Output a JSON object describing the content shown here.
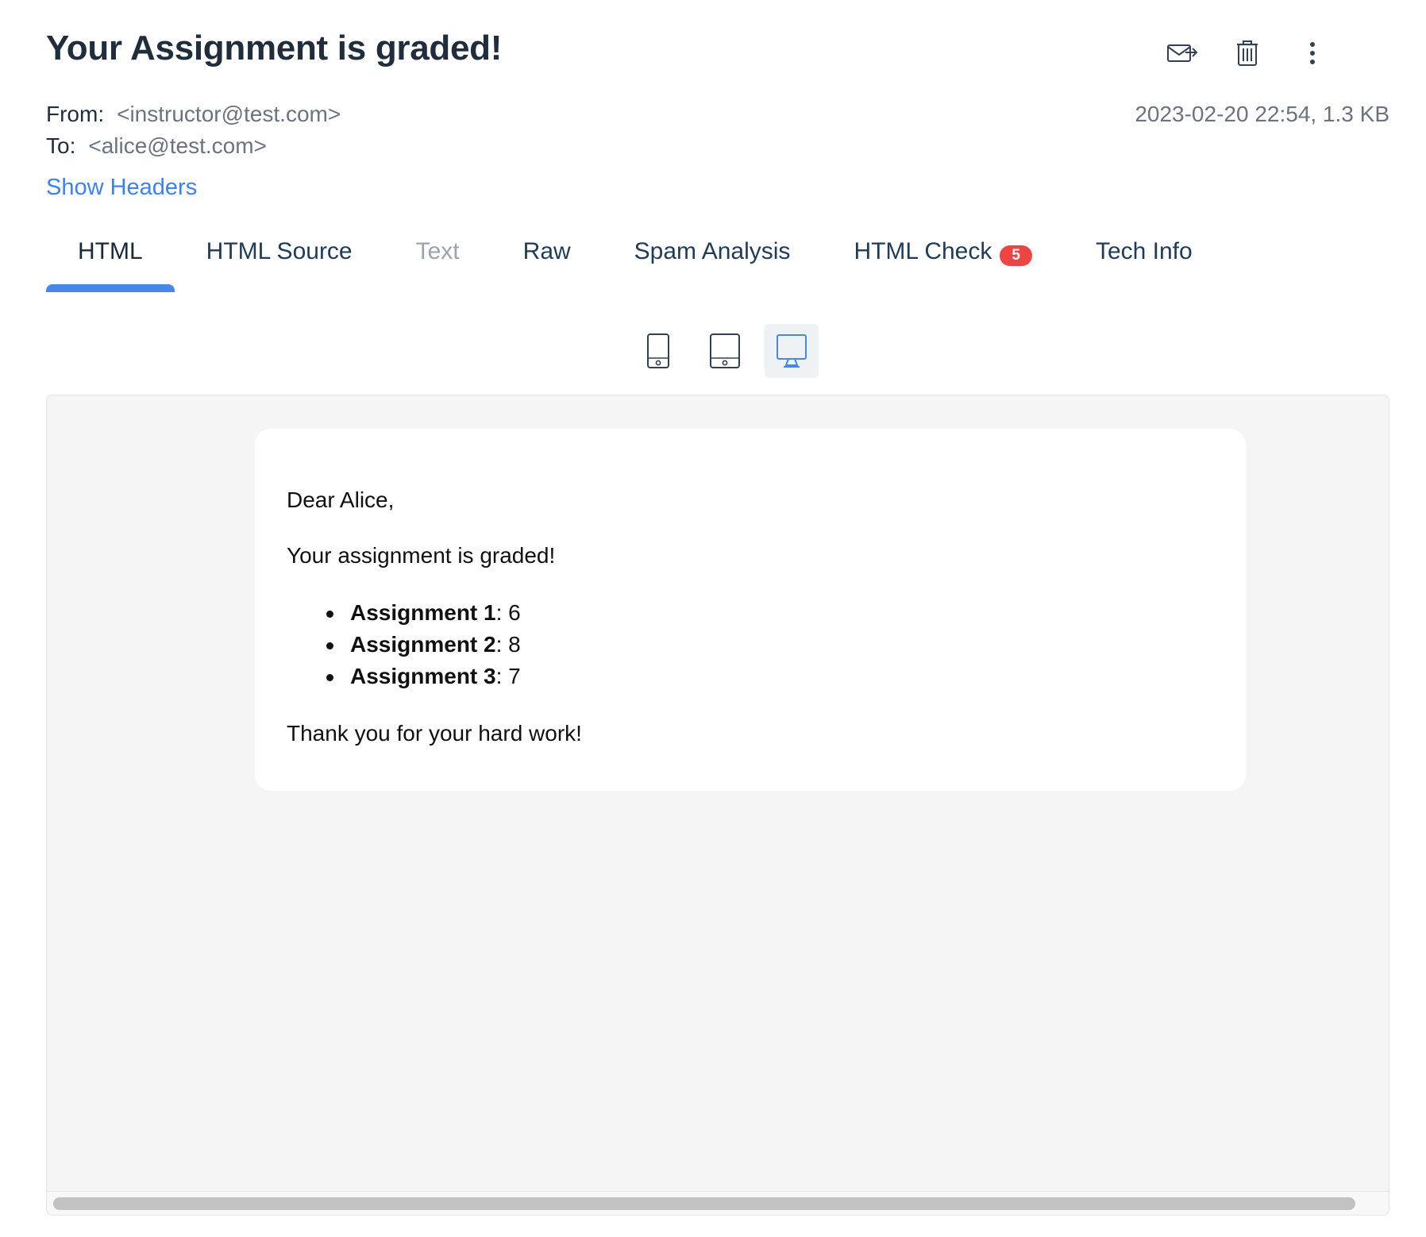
{
  "email": {
    "subject": "Your Assignment is graded!",
    "from_label": "From:",
    "from_value": "<instructor@test.com>",
    "to_label": "To:",
    "to_value": "<alice@test.com>",
    "date_size": "2023-02-20 22:54, 1.3 KB",
    "show_headers": "Show Headers"
  },
  "actions": [
    {
      "icon": "release-mail-icon"
    },
    {
      "icon": "trash-icon"
    },
    {
      "icon": "more-vertical-icon"
    }
  ],
  "tabs": [
    {
      "label": "HTML",
      "active": true
    },
    {
      "label": "HTML Source"
    },
    {
      "label": "Text",
      "disabled": true
    },
    {
      "label": "Raw"
    },
    {
      "label": "Spam Analysis"
    },
    {
      "label": "HTML Check",
      "badge": "5"
    },
    {
      "label": "Tech Info"
    }
  ],
  "devices": [
    {
      "icon": "phone-icon"
    },
    {
      "icon": "tablet-icon"
    },
    {
      "icon": "desktop-icon",
      "active": true
    }
  ],
  "colors": {
    "accent": "#4a86e8",
    "link": "#3b82f6",
    "badge": "#ef4444",
    "title": "#1f2d3d"
  },
  "body": {
    "greeting": "Dear Alice,",
    "intro": "Your assignment is graded!",
    "grades": [
      {
        "name": "Assignment 1",
        "score": ": 6"
      },
      {
        "name": "Assignment 2",
        "score": ": 8"
      },
      {
        "name": "Assignment 3",
        "score": ": 7"
      }
    ],
    "closing": "Thank you for your hard work!"
  }
}
